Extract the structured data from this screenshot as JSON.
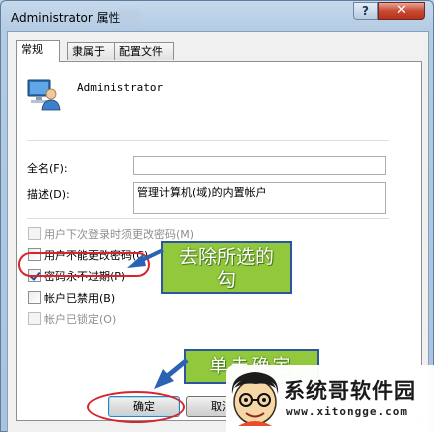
{
  "window": {
    "title": "Administrator 属性",
    "help_label": "?",
    "close_label": "✕"
  },
  "tabs": [
    {
      "label": "常规",
      "active": true
    },
    {
      "label": "隶属于",
      "active": false
    },
    {
      "label": "配置文件",
      "active": false
    }
  ],
  "general": {
    "username": "Administrator",
    "full_name_label": "全名(F):",
    "full_name_value": "",
    "description_label": "描述(D):",
    "description_value": "管理计算机(域)的内置帐户"
  },
  "checkboxes": [
    {
      "label": "用户下次登录时须更改密码(M)",
      "checked": false,
      "enabled": false
    },
    {
      "label": "用户不能更改密码(C)",
      "checked": false,
      "enabled": true
    },
    {
      "label": "密码永不过期(P)",
      "checked": true,
      "enabled": true
    },
    {
      "label": "帐户已禁用(B)",
      "checked": false,
      "enabled": true
    },
    {
      "label": "帐户已锁定(O)",
      "checked": false,
      "enabled": false
    }
  ],
  "annotations": {
    "callout_uncheck": "去除所选的\n勾",
    "callout_ok": "单击确定"
  },
  "buttons": {
    "ok": "确定",
    "cancel": "取消"
  },
  "watermark": {
    "title": "系统哥软件园",
    "url": "www.xitongge.com"
  },
  "colors": {
    "callout_fill": "#92c83c",
    "callout_border": "#2c55a0",
    "highlight_oval": "#d8242f",
    "arrow": "#2a62b4"
  },
  "icons": [
    "user-account-icon",
    "help-icon",
    "close-icon",
    "cartoon-face-icon"
  ]
}
